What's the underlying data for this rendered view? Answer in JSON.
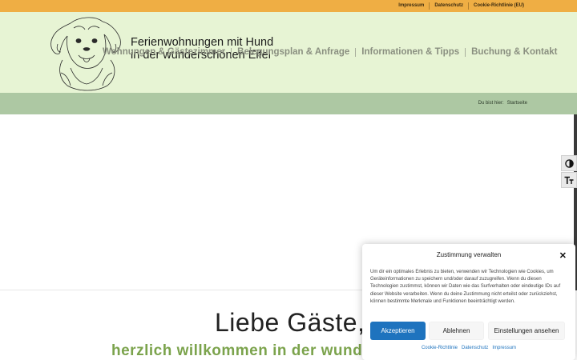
{
  "topbar": {
    "links": [
      "Impressum",
      "Datenschutz",
      "Cookie-Richtlinie (EU)"
    ]
  },
  "header": {
    "title_line1": "Ferienwohnungen mit Hund",
    "title_line2": "in der wunderschönen Eifel",
    "nav": [
      "Wohnungen & Gästezimmer",
      "Belegungsplan & Anfrage",
      "Informationen & Tipps",
      "Buchung & Kontakt"
    ]
  },
  "breadcrumb": {
    "prefix": "Du bist hier:",
    "current": "Startseite"
  },
  "accessibility": {
    "contrast_icon": "contrast-icon",
    "font_icon": "font-size-icon"
  },
  "content": {
    "greeting": "Liebe Gäste,",
    "welcome": "herzlich willkommen in der wunde"
  },
  "cookie": {
    "title": "Zustimmung verwalten",
    "text": "Um dir ein optimales Erlebnis zu bieten, verwenden wir Technologien wie Cookies, um Geräteinformationen zu speichern und/oder darauf zuzugreifen. Wenn du diesen Technologien zustimmst, können wir Daten wie das Surfverhalten oder eindeutige IDs auf dieser Website verarbeiten. Wenn du deine Zustimmung nicht erteilst oder zurückziehst, können bestimmte Merkmale und Funktionen beeinträchtigt werden.",
    "accept": "Akzeptieren",
    "deny": "Ablehnen",
    "settings": "Einstellungen ansehen",
    "links": [
      "Cookie-Richtlinie",
      "Datenschutz",
      "Impressum"
    ]
  },
  "colors": {
    "topbar": "#efae44",
    "header": "#e7f4d4",
    "breadcrumb": "#adc8a3",
    "accent_green": "#7ba34c",
    "button_blue": "#1e73be"
  }
}
